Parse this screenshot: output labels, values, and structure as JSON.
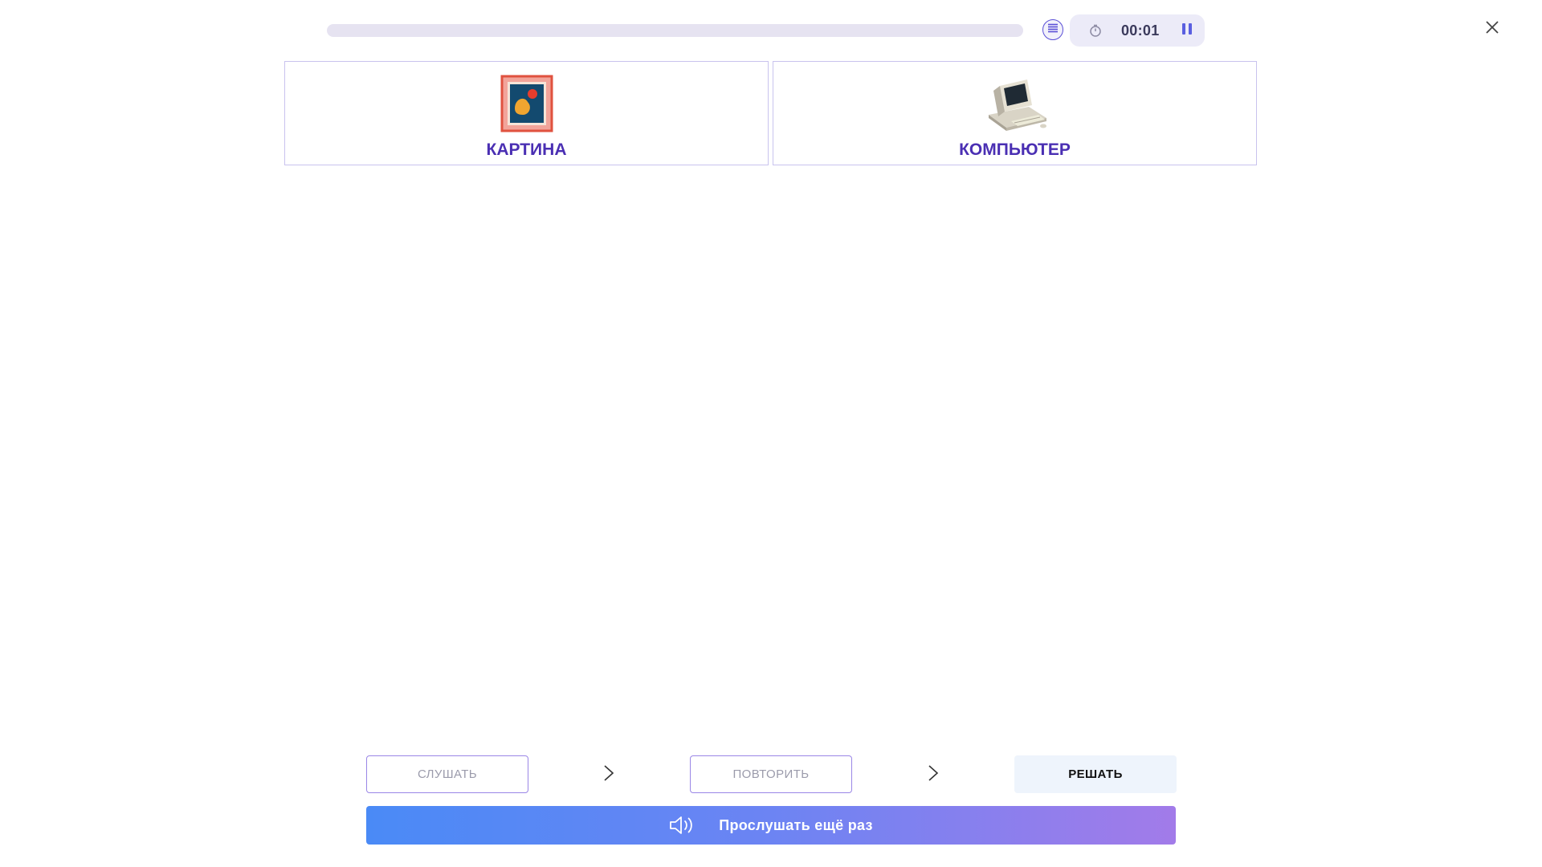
{
  "header": {
    "progress_fraction": 0,
    "timer": "00:01"
  },
  "cards": [
    {
      "label": "КАРТИНА",
      "icon": "framed-picture-icon"
    },
    {
      "label": "КОМПЬЮТЕР",
      "icon": "computer-icon"
    }
  ],
  "steps": {
    "listen_label": "СЛУШАТЬ",
    "repeat_label": "ПОВТОРИТЬ",
    "solve_label": "РЕШАТЬ"
  },
  "listen_again": {
    "label": "Прослушать ещё раз"
  },
  "colors": {
    "accent": "#4a2fb3",
    "gradient_start": "#4a8af6",
    "gradient_end": "#a27be9"
  }
}
